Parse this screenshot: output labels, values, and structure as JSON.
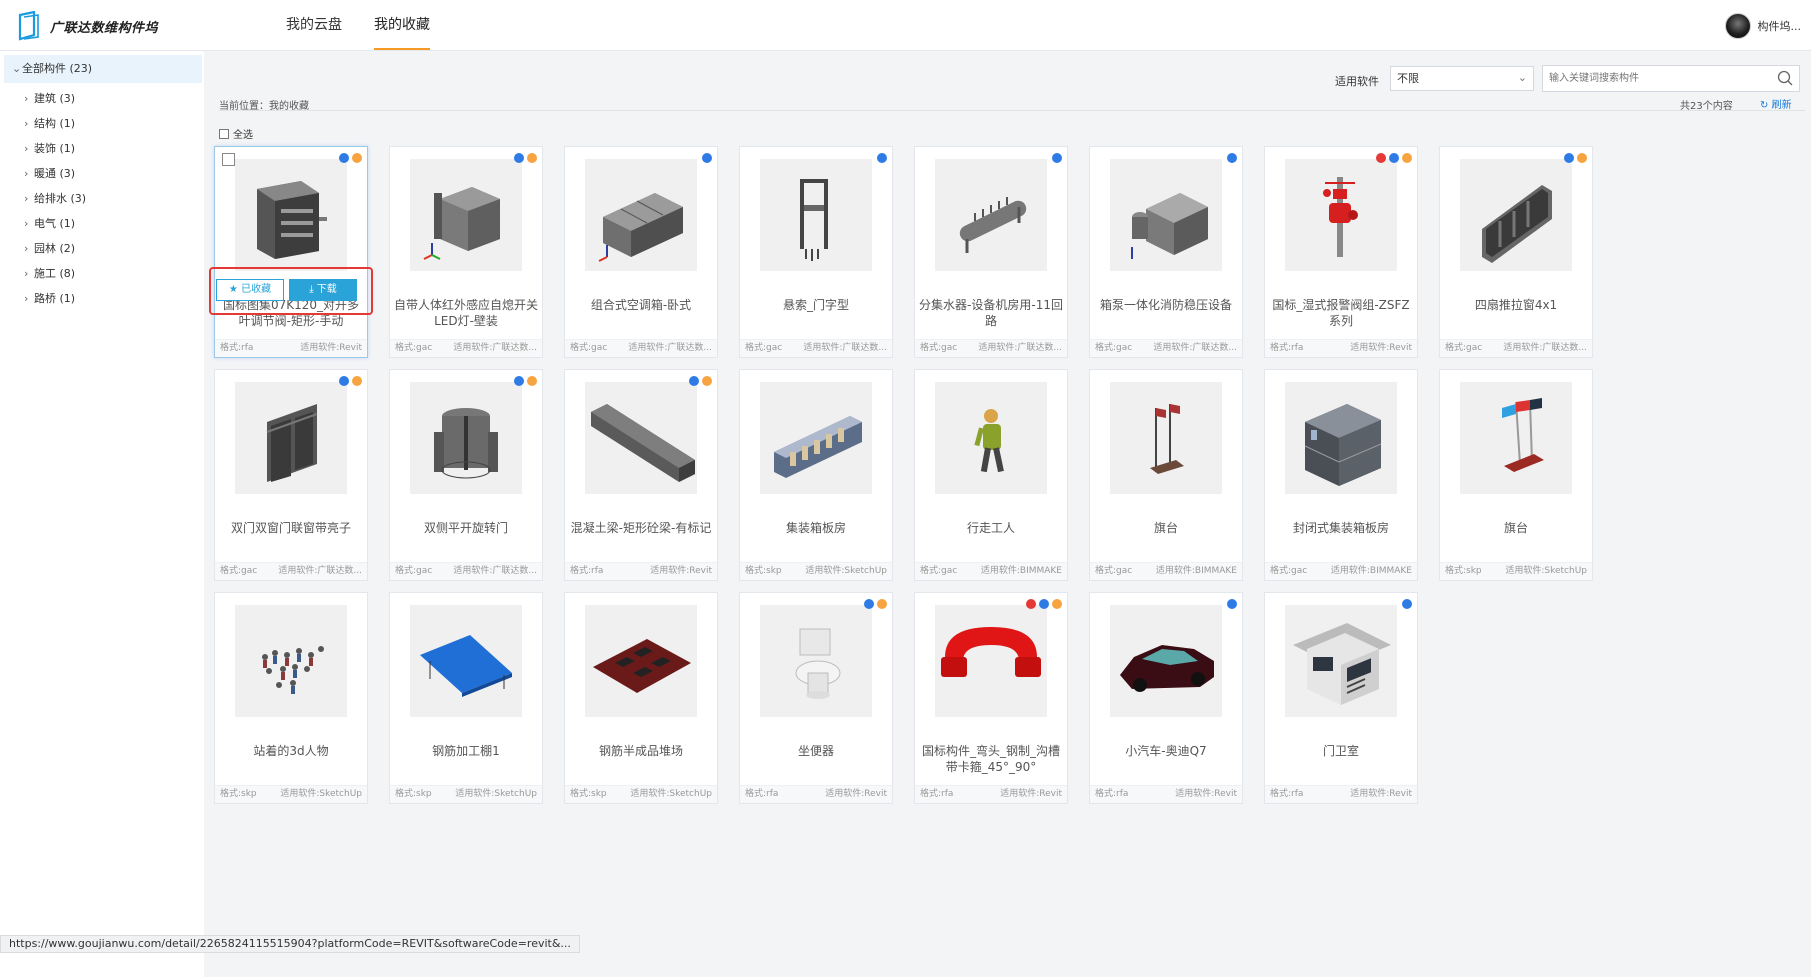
{
  "header": {
    "logo_text": "广联达数维构件坞",
    "tabs": [
      {
        "label": "我的云盘"
      },
      {
        "label": "我的收藏"
      }
    ],
    "user_name": "构件坞..."
  },
  "sidebar": {
    "root": "全部构件 (23)",
    "items": [
      {
        "label": "建筑 (3)"
      },
      {
        "label": "结构 (1)"
      },
      {
        "label": "装饰 (1)"
      },
      {
        "label": "暖通 (3)"
      },
      {
        "label": "给排水 (3)"
      },
      {
        "label": "电气 (1)"
      },
      {
        "label": "园林 (2)"
      },
      {
        "label": "施工 (8)"
      },
      {
        "label": "路桥 (1)"
      }
    ]
  },
  "toolbar": {
    "software_label": "适用软件",
    "software_value": "不限",
    "search_placeholder": "输入关键词搜索构件"
  },
  "location": {
    "crumb": "当前位置：我的收藏",
    "count": "共23个内容",
    "refresh": "刷新",
    "select_all": "全选"
  },
  "hover_actions": {
    "favorited": "已收藏",
    "download": "下载"
  },
  "cards": [
    {
      "title": "国标图集07K120_对开多叶调节阀-矩形-手动",
      "format": "格式:rfa",
      "software": "适用软件:Revit",
      "icon": "damper",
      "badges": [
        "blue",
        "orange"
      ]
    },
    {
      "title": "自带人体红外感应自熄开关LED灯-壁装",
      "format": "格式:gac",
      "software": "适用软件:广联达数...",
      "icon": "wall-lamp",
      "badges": [
        "blue",
        "orange"
      ]
    },
    {
      "title": "组合式空调箱-卧式",
      "format": "格式:gac",
      "software": "适用软件:广联达数...",
      "icon": "ahu",
      "badges": [
        "blue"
      ]
    },
    {
      "title": "悬索_门字型",
      "format": "格式:gac",
      "software": "适用软件:广联达数...",
      "icon": "suspension",
      "badges": [
        "blue"
      ]
    },
    {
      "title": "分集水器-设备机房用-11回路",
      "format": "格式:gac",
      "software": "适用软件:广联达数...",
      "icon": "manifold",
      "badges": [
        "blue"
      ]
    },
    {
      "title": "箱泵一体化消防稳压设备",
      "format": "格式:gac",
      "software": "适用软件:广联达数...",
      "icon": "pump-box",
      "badges": [
        "blue"
      ]
    },
    {
      "title": "国标_湿式报警阀组-ZSFZ系列",
      "format": "格式:rfa",
      "software": "适用软件:Revit",
      "icon": "alarm-valve",
      "badges": [
        "red",
        "blue",
        "orange"
      ]
    },
    {
      "title": "四扇推拉窗4x1",
      "format": "格式:gac",
      "software": "适用软件:广联达数...",
      "icon": "window",
      "badges": [
        "blue",
        "orange"
      ]
    },
    {
      "title": "双门双窗门联窗带亮子",
      "format": "格式:gac",
      "software": "适用软件:广联达数...",
      "icon": "door-window",
      "badges": [
        "blue",
        "orange"
      ]
    },
    {
      "title": "双侧平开旋转门",
      "format": "格式:gac",
      "software": "适用软件:广联达数...",
      "icon": "revolving-door",
      "badges": [
        "blue",
        "orange"
      ]
    },
    {
      "title": "混凝土梁-矩形砼梁-有标记",
      "format": "格式:rfa",
      "software": "适用软件:Revit",
      "icon": "beam",
      "badges": [
        "blue",
        "orange"
      ]
    },
    {
      "title": "集装箱板房",
      "format": "格式:skp",
      "software": "适用软件:SketchUp",
      "icon": "container-house",
      "badges": []
    },
    {
      "title": "行走工人",
      "format": "格式:gac",
      "software": "适用软件:BIMMAKE",
      "icon": "worker",
      "badges": []
    },
    {
      "title": "旗台",
      "format": "格式:gac",
      "software": "适用软件:BIMMAKE",
      "icon": "flag-stand",
      "badges": []
    },
    {
      "title": "封闭式集装箱板房",
      "format": "格式:gac",
      "software": "适用软件:BIMMAKE",
      "icon": "closed-container",
      "badges": []
    },
    {
      "title": "旗台",
      "format": "格式:skp",
      "software": "适用软件:SketchUp",
      "icon": "flag-stand-color",
      "badges": []
    },
    {
      "title": "站着的3d人物",
      "format": "格式:skp",
      "software": "适用软件:SketchUp",
      "icon": "crowd",
      "badges": []
    },
    {
      "title": "钢筋加工棚1",
      "format": "格式:skp",
      "software": "适用软件:SketchUp",
      "icon": "shed",
      "badges": []
    },
    {
      "title": "钢筋半成品堆场",
      "format": "格式:skp",
      "software": "适用软件:SketchUp",
      "icon": "rebar-yard",
      "badges": []
    },
    {
      "title": "坐便器",
      "format": "格式:rfa",
      "software": "适用软件:Revit",
      "icon": "toilet",
      "badges": [
        "blue",
        "orange"
      ]
    },
    {
      "title": "国标构件_弯头_钢制_沟槽带卡箍_45°_90°",
      "format": "格式:rfa",
      "software": "适用软件:Revit",
      "icon": "elbow",
      "badges": [
        "red",
        "blue",
        "orange"
      ]
    },
    {
      "title": "小汽车-奥迪Q7",
      "format": "格式:rfa",
      "software": "适用软件:Revit",
      "icon": "car",
      "badges": [
        "blue"
      ]
    },
    {
      "title": "门卫室",
      "format": "格式:rfa",
      "software": "适用软件:Revit",
      "icon": "guard-house",
      "badges": [
        "blue"
      ]
    }
  ],
  "status_url": "https://www.goujianwu.com/detail/2265824115515904?platformCode=REVIT&softwareCode=revit&..."
}
